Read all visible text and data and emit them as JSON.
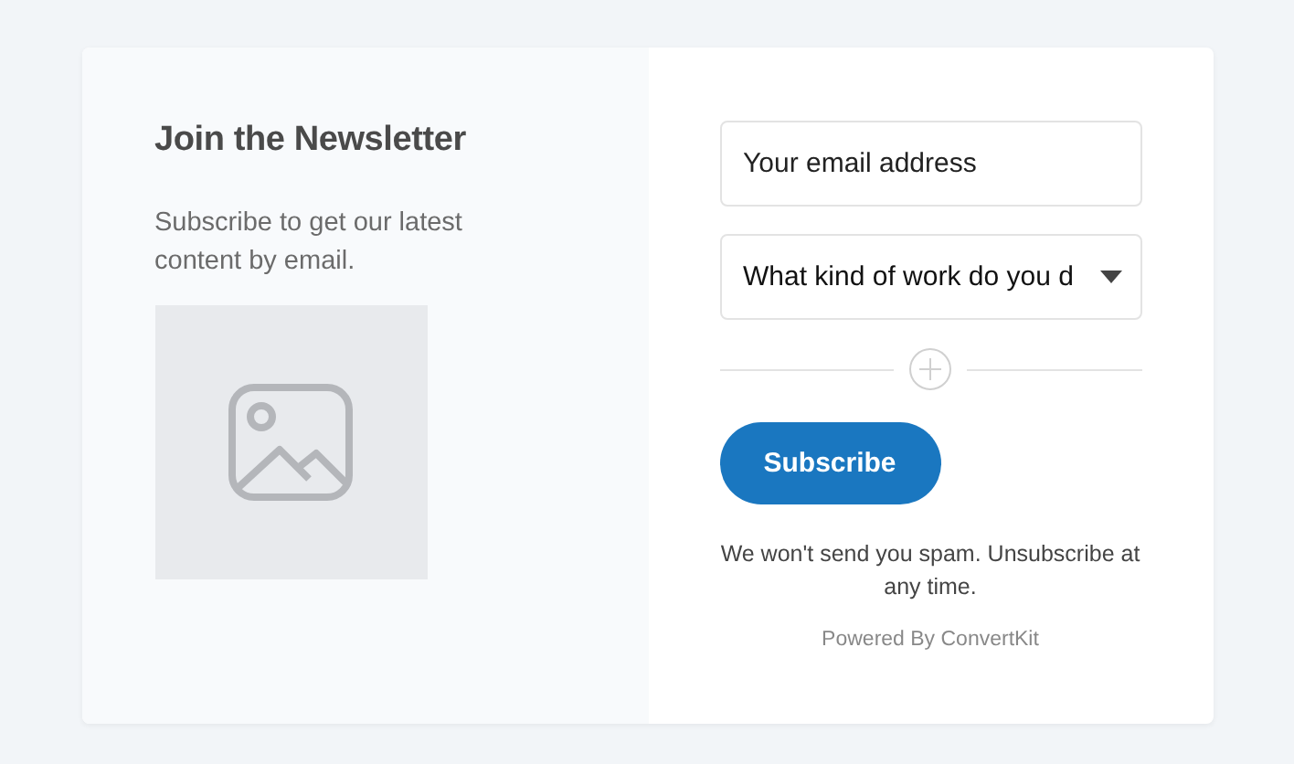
{
  "heading": "Join the Newsletter",
  "description": "Subscribe to get our latest content by email.",
  "image": {
    "kind": "placeholder"
  },
  "email_field": {
    "placeholder": "Your email address"
  },
  "work_select": {
    "value": "What kind of work do you d"
  },
  "subscribe_button": "Subscribe",
  "disclaimer": "We won't send you spam. Unsubscribe at any time.",
  "powered_by": "Powered By ConvertKit"
}
